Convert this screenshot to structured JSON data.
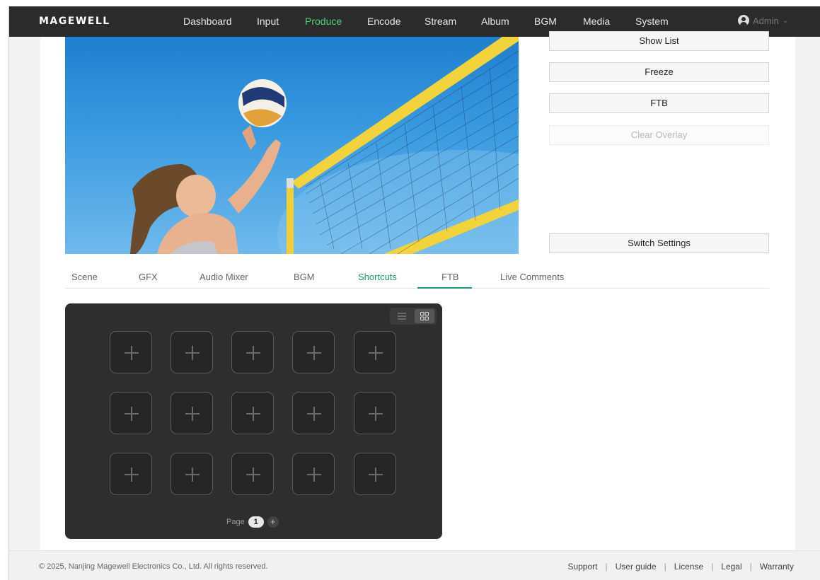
{
  "brand": {
    "logo": "MAGEWELL"
  },
  "nav": {
    "items": [
      {
        "label": "Dashboard",
        "active": false
      },
      {
        "label": "Input",
        "active": false
      },
      {
        "label": "Produce",
        "active": true
      },
      {
        "label": "Encode",
        "active": false
      },
      {
        "label": "Stream",
        "active": false
      },
      {
        "label": "Album",
        "active": false
      },
      {
        "label": "BGM",
        "active": false
      },
      {
        "label": "Media",
        "active": false
      },
      {
        "label": "System",
        "active": false
      }
    ],
    "user": {
      "name": "Admin",
      "icon": "user-avatar-icon"
    }
  },
  "controls": {
    "show_list": "Show List",
    "freeze": "Freeze",
    "ftb": "FTB",
    "clear_overlay": "Clear Overlay",
    "switch_settings": "Switch Settings"
  },
  "tabs": [
    {
      "label": "Scene",
      "active": false
    },
    {
      "label": "GFX",
      "active": false
    },
    {
      "label": "Audio Mixer",
      "active": false
    },
    {
      "label": "BGM",
      "active": false
    },
    {
      "label": "Shortcuts",
      "active": true
    },
    {
      "label": "FTB",
      "active": false
    },
    {
      "label": "Live Comments",
      "active": false
    }
  ],
  "shortcuts": {
    "view_modes": [
      "list-view-icon",
      "grid-view-icon"
    ],
    "active_view": "grid",
    "slots": 15,
    "slot_icon": "plus-icon",
    "pager": {
      "label": "Page",
      "current": "1",
      "add": "+"
    }
  },
  "footer": {
    "copyright": "© 2025, Nanjing Magewell Electronics Co., Ltd. All rights reserved.",
    "links": [
      "Support",
      "User guide",
      "License",
      "Legal",
      "Warranty"
    ]
  },
  "colors": {
    "nav_bg": "#2b2b2b",
    "accent": "#1c9a68",
    "nav_active": "#4fd67e",
    "panel_bg": "#2e2e2e"
  }
}
